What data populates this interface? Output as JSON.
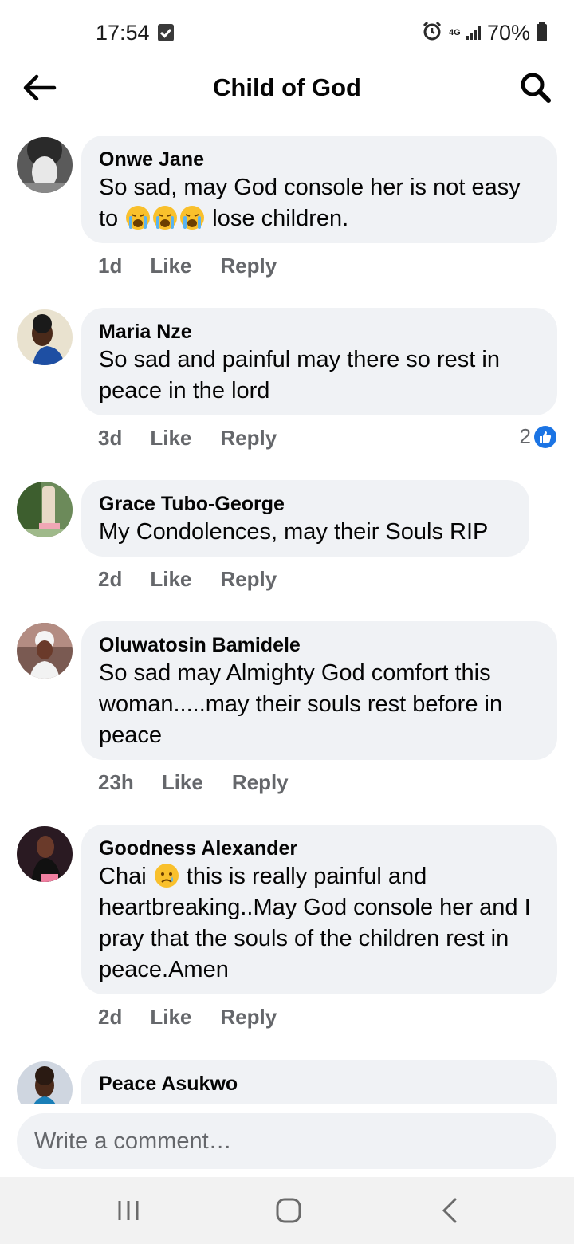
{
  "status_bar": {
    "time": "17:54",
    "network": "4G",
    "battery": "70%"
  },
  "header": {
    "title": "Child of God"
  },
  "comments": [
    {
      "author": "Onwe Jane",
      "text_before": "So sad, may God console her is not easy to ",
      "emojis": [
        "crying-face",
        "crying-face",
        "crying-face"
      ],
      "text_after": " lose children.",
      "time": "1d",
      "like": "Like",
      "reply": "Reply"
    },
    {
      "author": "Maria Nze",
      "text": "So sad and painful may there so rest in peace in the lord",
      "time": "3d",
      "like": "Like",
      "reply": "Reply",
      "reaction_count": "2"
    },
    {
      "author": "Grace Tubo-George",
      "text": "My Condolences, may their Souls RIP",
      "time": "2d",
      "like": "Like",
      "reply": "Reply"
    },
    {
      "author": "Oluwatosin Bamidele",
      "text": "So sad may Almighty God comfort this woman.....may their souls rest before in peace",
      "time": "23h",
      "like": "Like",
      "reply": "Reply"
    },
    {
      "author": "Goodness Alexander",
      "text_before": "Chai ",
      "emojis": [
        "sad-tear-face"
      ],
      "text_after": " this is really painful and heartbreaking..May God console her and I pray that the souls of the children rest in peace.Amen",
      "time": "2d",
      "like": "Like",
      "reply": "Reply"
    },
    {
      "author": "Peace Asukwo"
    }
  ],
  "composer": {
    "placeholder": "Write a comment…"
  },
  "colors": {
    "bubble": "#f0f2f5",
    "meta": "#65676b",
    "like_blue": "#1b74e4"
  }
}
